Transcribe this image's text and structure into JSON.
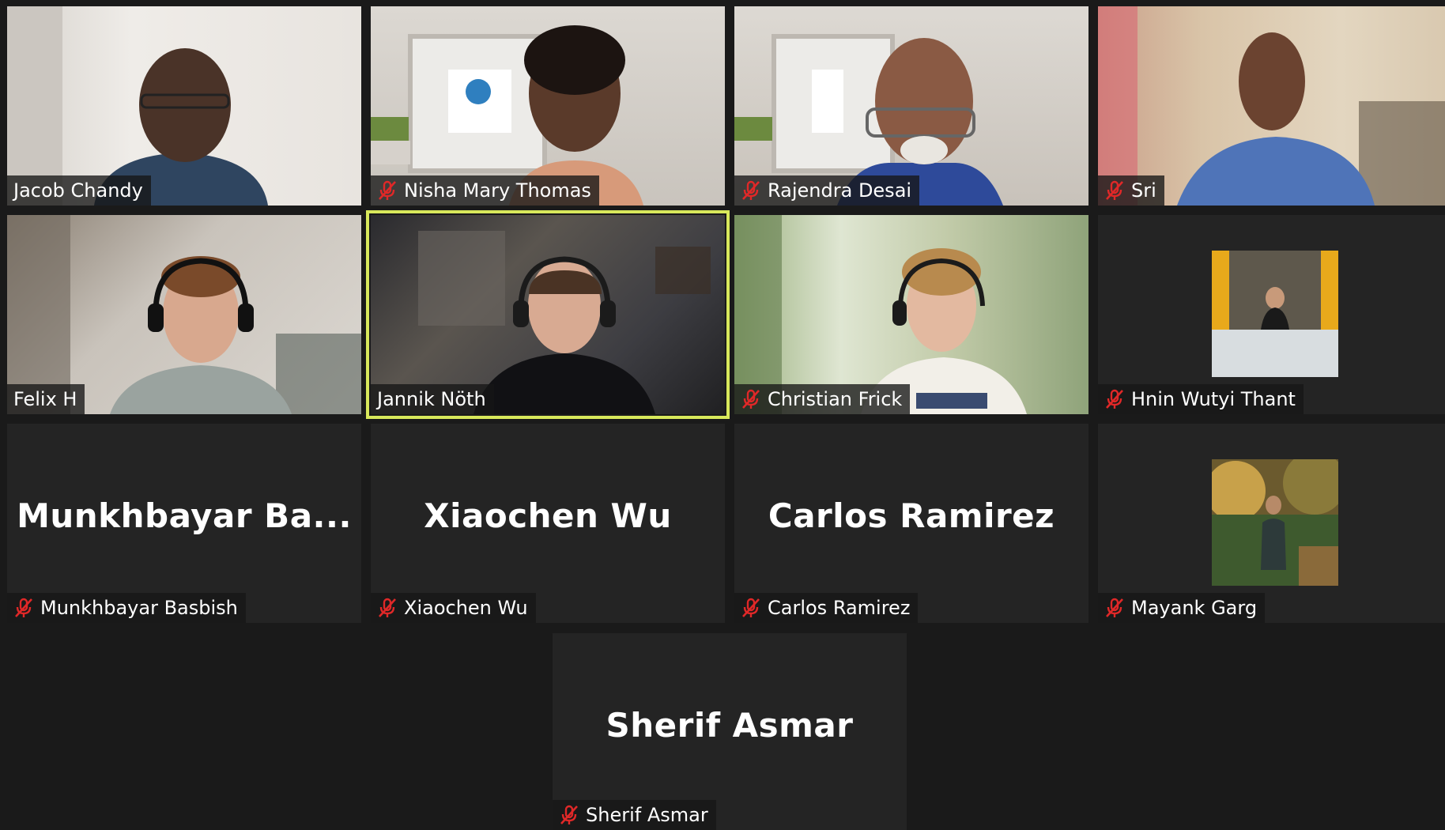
{
  "participants": [
    {
      "name": "Jacob Chandy",
      "muted": false,
      "mode": "video"
    },
    {
      "name": "Nisha Mary Thomas",
      "muted": true,
      "mode": "video"
    },
    {
      "name": "Rajendra Desai",
      "muted": true,
      "mode": "video"
    },
    {
      "name": "Sri",
      "muted": true,
      "mode": "video"
    },
    {
      "name": "Felix H",
      "muted": false,
      "mode": "video"
    },
    {
      "name": "Jannik Nöth",
      "muted": false,
      "mode": "video",
      "speaking": true
    },
    {
      "name": "Christian Frick",
      "muted": true,
      "mode": "video"
    },
    {
      "name": "Hnin Wutyi Thant",
      "muted": true,
      "mode": "profile-photo"
    },
    {
      "name": "Munkhbayar Basbish",
      "display_name": "Munkhbayar  Ba...",
      "muted": true,
      "mode": "name-only"
    },
    {
      "name": "Xiaochen Wu",
      "display_name": "Xiaochen Wu",
      "muted": true,
      "mode": "name-only"
    },
    {
      "name": "Carlos Ramirez",
      "display_name": "Carlos Ramirez",
      "muted": true,
      "mode": "name-only"
    },
    {
      "name": "Mayank Garg",
      "muted": true,
      "mode": "profile-photo"
    },
    {
      "name": "Sherif Asmar",
      "display_name": "Sherif Asmar",
      "muted": true,
      "mode": "name-only"
    }
  ],
  "icons": {
    "muted_mic": "mic-off-icon"
  },
  "colors": {
    "background": "#1a1a1a",
    "tile_background": "#242424",
    "active_speaker_border": "#d8e85b",
    "muted_icon": "#e02828"
  }
}
